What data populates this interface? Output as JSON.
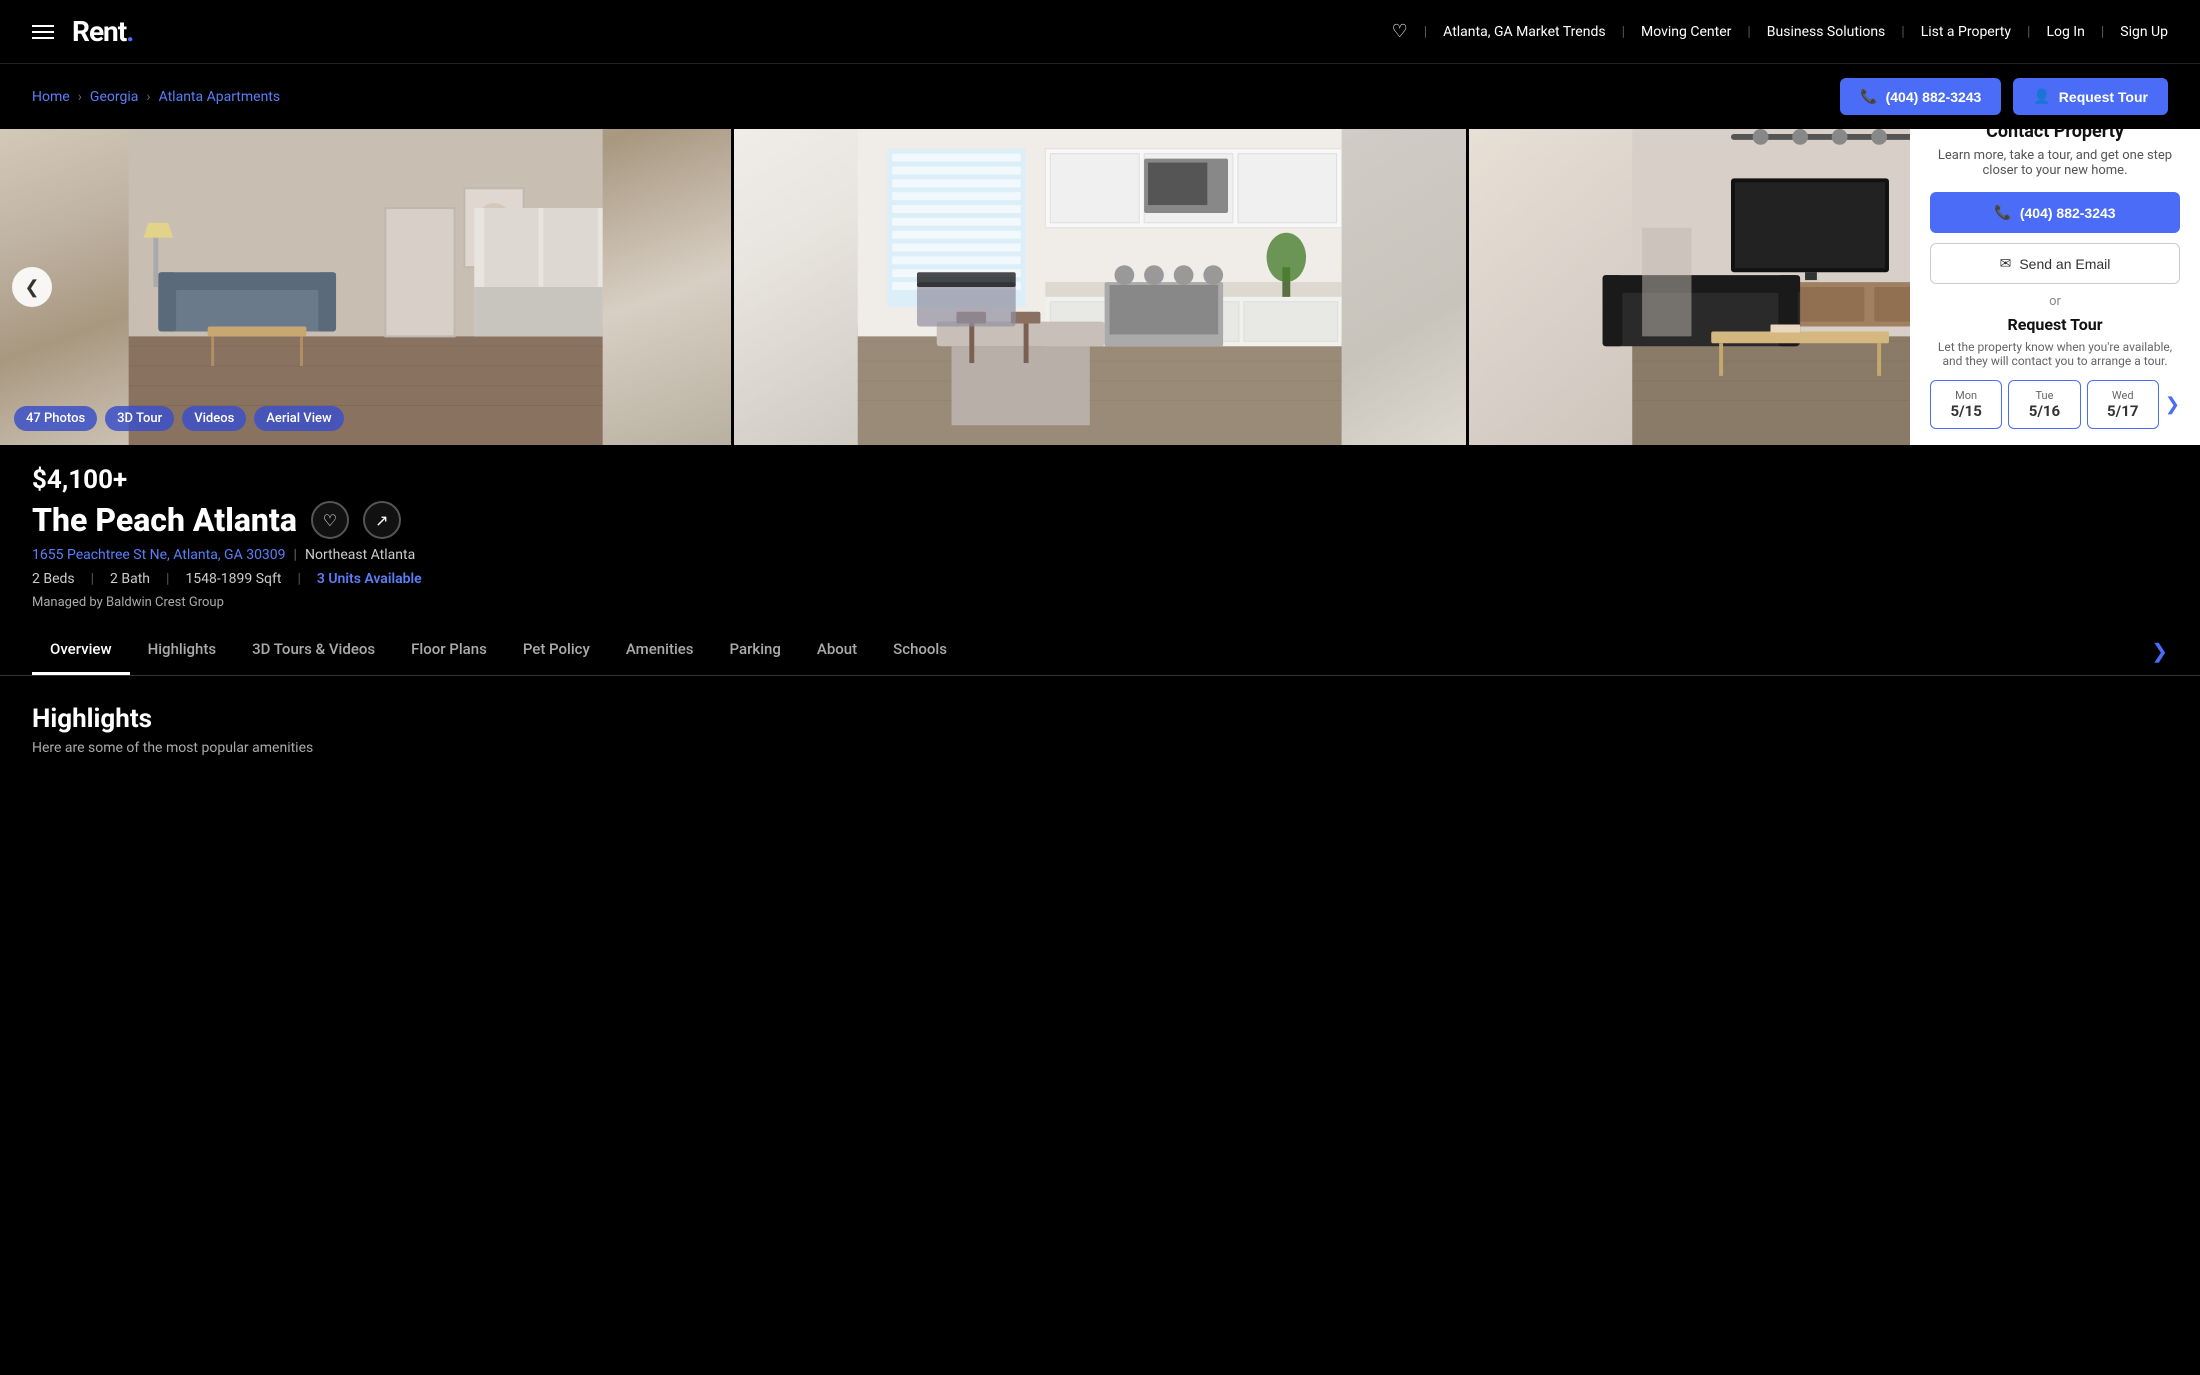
{
  "header": {
    "logo": "Rent.",
    "logo_dot": ".",
    "nav": {
      "heart_label": "♡",
      "market_trends": "Atlanta, GA Market Trends",
      "moving_center": "Moving Center",
      "business_solutions": "Business Solutions",
      "list_property": "List a Property",
      "login": "Log In",
      "signup": "Sign Up"
    }
  },
  "breadcrumb": {
    "home": "Home",
    "state": "Georgia",
    "city": "Atlanta Apartments"
  },
  "cta_buttons": {
    "phone_label": "📞 (404) 882-3243",
    "tour_label": "👤 Request Tour"
  },
  "gallery": {
    "photos_count": "47 Photos",
    "tour_3d": "3D Tour",
    "videos": "Videos",
    "aerial_view": "Aerial View"
  },
  "property": {
    "price": "$4,100+",
    "name": "The Peach Atlanta",
    "address": "1655 Peachtree St Ne, Atlanta, GA 30309",
    "neighborhood": "Northeast Atlanta",
    "beds": "2 Beds",
    "baths": "2 Bath",
    "sqft": "1548-1899 Sqft",
    "units_available": "3 Units Available",
    "managed_by": "Managed by Baldwin Crest Group"
  },
  "tabs": [
    {
      "label": "Overview",
      "active": true
    },
    {
      "label": "Highlights"
    },
    {
      "label": "3D Tours & Videos"
    },
    {
      "label": "Floor Plans"
    },
    {
      "label": "Pet Policy"
    },
    {
      "label": "Amenities"
    },
    {
      "label": "Parking"
    },
    {
      "label": "About"
    },
    {
      "label": "Schools"
    }
  ],
  "highlights": {
    "title": "Highlights",
    "subtitle": "Here are some of the most popular amenities"
  },
  "contact_card": {
    "title": "Contact Property",
    "description": "Learn more, take a tour, and get one step closer to your new home.",
    "phone": "(404) 882-3243",
    "email_label": "Send an Email",
    "or_text": "or",
    "tour_title": "Request Tour",
    "tour_desc": "Let the property know when you're available, and they will contact you to arrange a tour.",
    "dates": [
      {
        "day": "Mon",
        "date": "5/15"
      },
      {
        "day": "Tue",
        "date": "5/16"
      },
      {
        "day": "Wed",
        "date": "5/17"
      }
    ]
  },
  "icons": {
    "phone": "📞",
    "person": "👤",
    "heart": "♡",
    "share": "↗",
    "chevron_left": "❮",
    "chevron_right": "❯",
    "email": "✉"
  }
}
